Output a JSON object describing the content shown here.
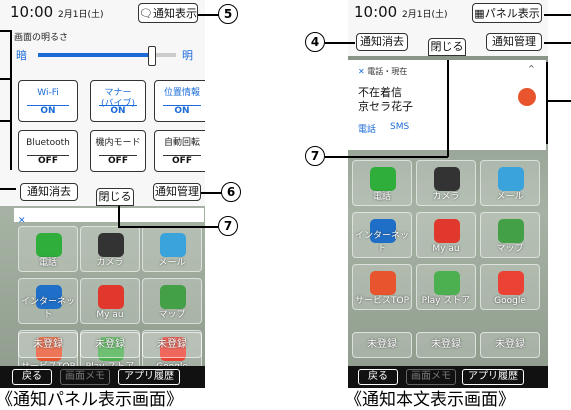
{
  "left": {
    "status_time": "10:00",
    "status_date": "2月1日(土)",
    "notify_show_btn": "通知表示",
    "brightness_title": "画面の明るさ",
    "dark_label": "暗",
    "bright_label": "明",
    "brightness_level": 0.82,
    "tiles": [
      {
        "label": "Wi-Fi",
        "state": "ON",
        "active": true
      },
      {
        "label": "マナー\n(バイブ)",
        "state": "ON",
        "active": true
      },
      {
        "label": "位置情報",
        "state": "ON",
        "active": true
      },
      {
        "label": "Bluetooth",
        "state": "OFF",
        "active": false
      },
      {
        "label": "機内モード",
        "state": "OFF",
        "active": false
      },
      {
        "label": "自動回転",
        "state": "OFF",
        "active": false
      }
    ],
    "clear_btn": "通知消去",
    "close_btn": "閉じる",
    "manage_btn": "通知管理",
    "caption": "《通知パネル表示画面》"
  },
  "right": {
    "status_time": "10:00",
    "status_date": "2月1日(土)",
    "panel_show_btn": "パネル表示",
    "clear_btn": "通知消去",
    "close_btn": "閉じる",
    "manage_btn": "通知管理",
    "notif_header": "電話・現在",
    "notif_title": "不在着信",
    "notif_name": "京セラ花子",
    "notif_action1": "電話",
    "notif_action2": "SMS",
    "caption": "《通知本文表示画面》"
  },
  "apps": [
    {
      "label": "電話",
      "color": "#2fae3c"
    },
    {
      "label": "カメラ",
      "color": "#333333"
    },
    {
      "label": "メール",
      "color": "#3aa3dc"
    },
    {
      "label": "インターネット",
      "color": "#1f6fc8"
    },
    {
      "label": "My au",
      "color": "#e0382c"
    },
    {
      "label": "マップ",
      "color": "#43a047"
    },
    {
      "label": "サービスTOP",
      "color": "#e8542d"
    },
    {
      "label": "Play ストア",
      "color": "#4caf50"
    },
    {
      "label": "Google",
      "color": "#ea4335"
    }
  ],
  "unregistered": "未登録",
  "nav": {
    "back": "戻る",
    "memo": "画面メモ",
    "history": "アプリ履歴"
  },
  "callouts": {
    "c4": "4",
    "c5": "5",
    "c6": "6",
    "c7a": "7",
    "c7b": "7"
  }
}
